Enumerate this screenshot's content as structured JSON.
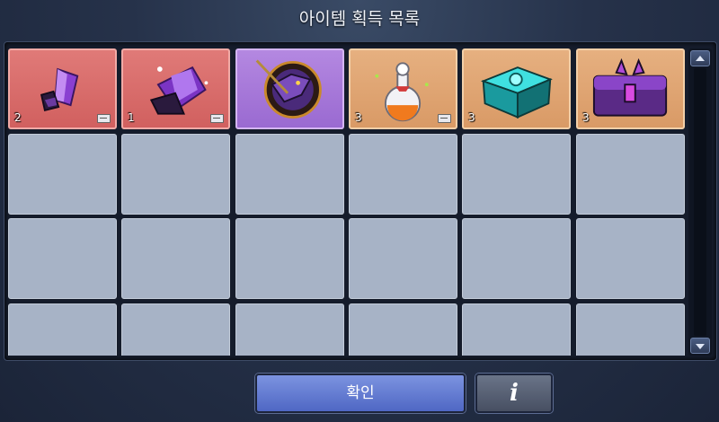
{
  "window": {
    "title": "아이템 획득 목록"
  },
  "items": [
    {
      "icon": "purple-crystal-shard-icon",
      "count": "2",
      "bound": true,
      "grade": "rare"
    },
    {
      "icon": "purple-crystal-cluster-icon",
      "count": "1",
      "bound": true,
      "grade": "rare"
    },
    {
      "icon": "dragon-emblem-icon",
      "count": "",
      "bound": false,
      "grade": "epic"
    },
    {
      "icon": "potion-bottle-icon",
      "count": "3",
      "bound": true,
      "grade": "normal"
    },
    {
      "icon": "teal-gem-box-icon",
      "count": "3",
      "bound": false,
      "grade": "normal"
    },
    {
      "icon": "purple-demon-chest-icon",
      "count": "3",
      "bound": false,
      "grade": "normal"
    }
  ],
  "grid": {
    "columns": 6,
    "visible_rows": 4,
    "empty_slot_color": "#a7b3c6"
  },
  "buttons": {
    "confirm_label": "확인",
    "info_label": "i"
  },
  "colors": {
    "rare": "#d96a68",
    "epic": "#a676d8",
    "normal": "#dea673",
    "confirm": "#6078d2"
  }
}
